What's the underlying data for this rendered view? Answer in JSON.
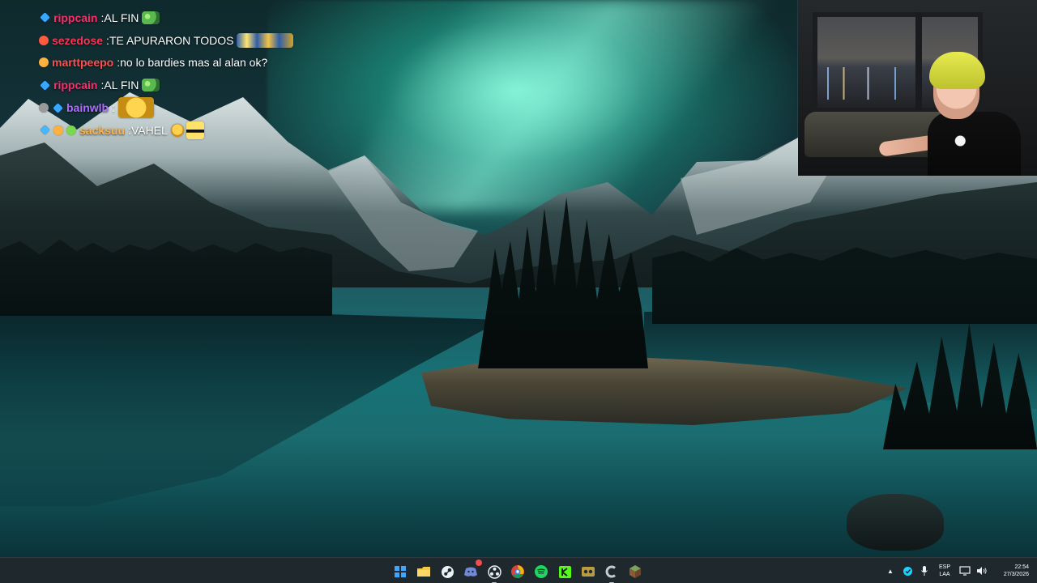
{
  "chat": {
    "messages": [
      {
        "user": "rippcain",
        "text": "AL FIN",
        "user_color": "#ff2b6d",
        "badges": [
          "#37a7ff"
        ],
        "emotes": [
          "frog-emote"
        ]
      },
      {
        "user": "sezedose",
        "text": "TE APURARON TODOS",
        "user_color": "#ff3154",
        "badges": [
          "#ff5a3f"
        ],
        "emotes": [
          "cars-emote"
        ]
      },
      {
        "user": "marttpeepo",
        "text": "no lo bardies mas al alan ok?",
        "user_color": "#ff4e4e",
        "badges": [
          "#ffb23f"
        ],
        "emotes": []
      },
      {
        "user": "rippcain",
        "text": "AL FIN",
        "user_color": "#ff2b6d",
        "badges": [
          "#37a7ff"
        ],
        "emotes": [
          "frog-emote"
        ]
      },
      {
        "user": "bainwlb",
        "text": "",
        "user_color": "#b06cff",
        "badges": [
          "#9a9a9a",
          "#37a7ff"
        ],
        "emotes": [
          "mouth-emote"
        ]
      },
      {
        "user": "sacksuu",
        "text": "VAHEL",
        "user_color": "#ffb347",
        "badges": [
          "#43b8ff",
          "#ffb23f",
          "#79d94d"
        ],
        "emotes": [
          "fist-emote",
          "glasses-emote"
        ]
      }
    ]
  },
  "taskbar": {
    "apps": [
      {
        "name": "windows-start-icon",
        "color": "#3ea6ff"
      },
      {
        "name": "file-explorer-icon",
        "color": "#f5c84a"
      },
      {
        "name": "steam-icon",
        "color": "#e9f2f7"
      },
      {
        "name": "discord-icon",
        "color": "#7289da",
        "badge": true
      },
      {
        "name": "obs-icon",
        "color": "#e9eff3"
      },
      {
        "name": "chrome-icon",
        "color": "#f0b400"
      },
      {
        "name": "spotify-icon",
        "color": "#1ed760"
      },
      {
        "name": "kick-icon",
        "color": "#53fc18"
      },
      {
        "name": "app-icon",
        "color": "#b99b44"
      },
      {
        "name": "active-app-icon",
        "color": "#c0cbd2",
        "active": true
      },
      {
        "name": "minecraft-icon",
        "color": "#7ca35d"
      }
    ],
    "tray": {
      "language_top": "ESP",
      "language_bottom": "LAA",
      "time": "22:54",
      "date": "27/3/2026"
    }
  }
}
